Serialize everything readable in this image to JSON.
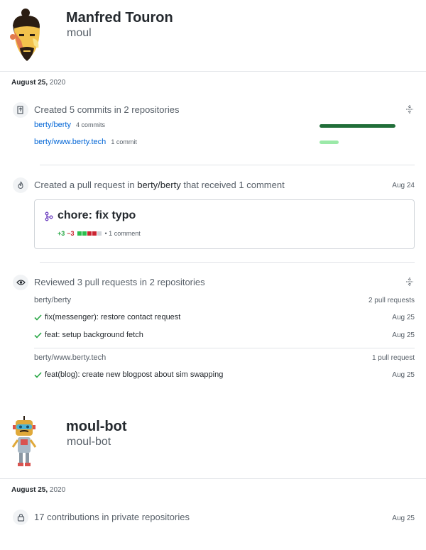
{
  "users": [
    {
      "name": "Manfred Touron",
      "login": "moul",
      "date": {
        "month_day": "August 25,",
        "year": "2020"
      }
    },
    {
      "name": "moul-bot",
      "login": "moul-bot",
      "date": {
        "month_day": "August 25,",
        "year": "2020"
      }
    }
  ],
  "commits_event": {
    "title": "Created 5 commits in 2 repositories",
    "repos": [
      {
        "name": "berty/berty",
        "count": "4 commits",
        "bar_fraction": 0.8,
        "bar_color": "#216e39"
      },
      {
        "name": "berty/www.berty.tech",
        "count": "1 commit",
        "bar_fraction": 0.2,
        "bar_color": "#9be9a8"
      }
    ]
  },
  "pr_event": {
    "title_prefix": "Created a pull request in",
    "repo": "berty/berty",
    "title_suffix": "that received 1 comment",
    "date": "Aug 24",
    "pr": {
      "title": "chore: fix typo",
      "additions": "+3",
      "deletions": "−3",
      "comments": "• 1 comment",
      "diff_colors": [
        "#2cbe4e",
        "#2cbe4e",
        "#cb2431",
        "#cb2431",
        "#d1d5da"
      ]
    }
  },
  "review_event": {
    "title": "Reviewed 3 pull requests in 2 repositories",
    "groups": [
      {
        "repo": "berty/berty",
        "count": "2 pull requests",
        "items": [
          {
            "title": "fix(messenger): restore contact request",
            "date": "Aug 25"
          },
          {
            "title": "feat: setup background fetch",
            "date": "Aug 25"
          }
        ]
      },
      {
        "repo": "berty/www.berty.tech",
        "count": "1 pull request",
        "items": [
          {
            "title": "feat(blog): create new blogpost about sim swapping",
            "date": "Aug 25"
          }
        ]
      }
    ]
  },
  "private_event": {
    "title": "17 contributions in private repositories",
    "date": "Aug 25"
  }
}
